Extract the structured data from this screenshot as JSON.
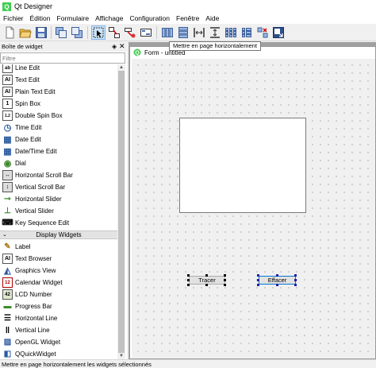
{
  "window": {
    "title": "Qt Designer"
  },
  "menubar": {
    "items": [
      "Fichier",
      "Édition",
      "Formulaire",
      "Affichage",
      "Configuration",
      "Fenêtre",
      "Aide"
    ]
  },
  "toolbar": {
    "tooltip": "Mettre en page horizontalement"
  },
  "widget_box": {
    "title": "Boîte de widget",
    "float_glyph": "◈",
    "close_glyph": "✕",
    "filter_placeholder": "Filtre",
    "items": [
      {
        "label": "Line Edit",
        "icon": "line-edit-icon",
        "glyph": "ab"
      },
      {
        "label": "Text Edit",
        "icon": "text-edit-icon",
        "glyph": "AI"
      },
      {
        "label": "Plain Text Edit",
        "icon": "plain-text-edit-icon",
        "glyph": "AI"
      },
      {
        "label": "Spin Box",
        "icon": "spin-box-icon",
        "glyph": "1"
      },
      {
        "label": "Double Spin Box",
        "icon": "double-spin-box-icon",
        "glyph": "1.2"
      },
      {
        "label": "Time Edit",
        "icon": "time-edit-icon",
        "glyph": "◷"
      },
      {
        "label": "Date Edit",
        "icon": "date-edit-icon",
        "glyph": "▦"
      },
      {
        "label": "Date/Time Edit",
        "icon": "date-time-edit-icon",
        "glyph": "▦"
      },
      {
        "label": "Dial",
        "icon": "dial-icon",
        "glyph": "◉"
      },
      {
        "label": "Horizontal Scroll Bar",
        "icon": "horizontal-scroll-bar-icon",
        "glyph": "↔"
      },
      {
        "label": "Vertical Scroll Bar",
        "icon": "vertical-scroll-bar-icon",
        "glyph": "↕"
      },
      {
        "label": "Horizontal Slider",
        "icon": "horizontal-slider-icon",
        "glyph": "⊸"
      },
      {
        "label": "Vertical Slider",
        "icon": "vertical-slider-icon",
        "glyph": "⊥"
      },
      {
        "label": "Key Sequence Edit",
        "icon": "key-sequence-edit-icon",
        "glyph": "⌨"
      }
    ],
    "category": {
      "label": "Display Widgets",
      "chevron": "⌄"
    },
    "display_items": [
      {
        "label": "Label",
        "icon": "label-icon",
        "glyph": "✎"
      },
      {
        "label": "Text Browser",
        "icon": "text-browser-icon",
        "glyph": "AI"
      },
      {
        "label": "Graphics View",
        "icon": "graphics-view-icon",
        "glyph": "◭"
      },
      {
        "label": "Calendar Widget",
        "icon": "calendar-widget-icon",
        "glyph": "12"
      },
      {
        "label": "LCD Number",
        "icon": "lcd-number-icon",
        "glyph": "42"
      },
      {
        "label": "Progress Bar",
        "icon": "progress-bar-icon",
        "glyph": "▬"
      },
      {
        "label": "Horizontal Line",
        "icon": "horizontal-line-icon",
        "glyph": "☰"
      },
      {
        "label": "Vertical Line",
        "icon": "vertical-line-icon",
        "glyph": "‖"
      },
      {
        "label": "OpenGL Widget",
        "icon": "opengl-widget-icon",
        "glyph": "▨"
      },
      {
        "label": "QQuickWidget",
        "icon": "qquickwidget-icon",
        "glyph": "◧"
      }
    ]
  },
  "form": {
    "title": "Form - untitled",
    "buttons": [
      {
        "label": "Tracer"
      },
      {
        "label": "Effacer"
      }
    ]
  },
  "statusbar": {
    "text": "Mettre en page horizontalement les widgets sélectionnés"
  }
}
